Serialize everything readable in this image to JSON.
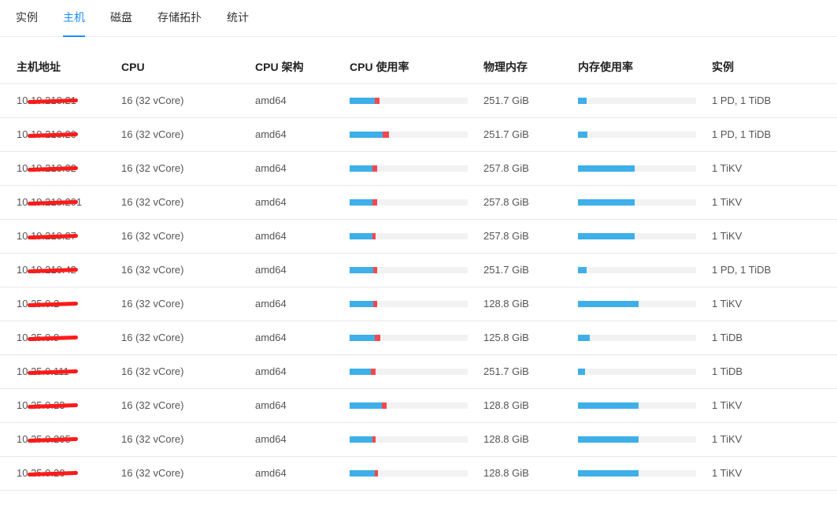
{
  "tabs": [
    {
      "label": "实例"
    },
    {
      "label": "主机",
      "active": true
    },
    {
      "label": "磁盘"
    },
    {
      "label": "存储拓扑"
    },
    {
      "label": "统计"
    }
  ],
  "columns": [
    "主机地址",
    "CPU",
    "CPU 架构",
    "CPU 使用率",
    "物理内存",
    "内存使用率",
    "实例"
  ],
  "colors": {
    "accent": "#1890ff",
    "cpu_user": "#3eafe9",
    "cpu_system": "#f5484e",
    "redaction": "#ff1a1a"
  },
  "rows": [
    {
      "address": "10.19.210.21",
      "cpu": "16 (32 vCore)",
      "arch": "amd64",
      "cpu_user": 0.21,
      "cpu_sys": 0.04,
      "memory": "251.7 GiB",
      "mem_usage": 0.07,
      "instances": "1 PD, 1 TiDB"
    },
    {
      "address": "10.19.210.20",
      "cpu": "16 (32 vCore)",
      "arch": "amd64",
      "cpu_user": 0.28,
      "cpu_sys": 0.05,
      "memory": "251.7 GiB",
      "mem_usage": 0.08,
      "instances": "1 PD, 1 TiDB"
    },
    {
      "address": "10.19.210.32",
      "cpu": "16 (32 vCore)",
      "arch": "amd64",
      "cpu_user": 0.19,
      "cpu_sys": 0.04,
      "memory": "257.8 GiB",
      "mem_usage": 0.48,
      "instances": "1 TiKV"
    },
    {
      "address": "10.19.210.201",
      "cpu": "16 (32 vCore)",
      "arch": "amd64",
      "cpu_user": 0.19,
      "cpu_sys": 0.04,
      "memory": "257.8 GiB",
      "mem_usage": 0.48,
      "instances": "1 TiKV"
    },
    {
      "address": "10.19.210.27",
      "cpu": "16 (32 vCore)",
      "arch": "amd64",
      "cpu_user": 0.19,
      "cpu_sys": 0.03,
      "memory": "257.8 GiB",
      "mem_usage": 0.48,
      "instances": "1 TiKV"
    },
    {
      "address": "10.19.210.42",
      "cpu": "16 (32 vCore)",
      "arch": "amd64",
      "cpu_user": 0.2,
      "cpu_sys": 0.03,
      "memory": "251.7 GiB",
      "mem_usage": 0.07,
      "instances": "1 PD, 1 TiDB"
    },
    {
      "address": "10.25.0.2",
      "cpu": "16 (32 vCore)",
      "arch": "amd64",
      "cpu_user": 0.2,
      "cpu_sys": 0.03,
      "memory": "128.8 GiB",
      "mem_usage": 0.51,
      "instances": "1 TiKV"
    },
    {
      "address": "10.25.0.9",
      "cpu": "16 (32 vCore)",
      "arch": "amd64",
      "cpu_user": 0.21,
      "cpu_sys": 0.05,
      "memory": "125.8 GiB",
      "mem_usage": 0.1,
      "instances": "1 TiDB"
    },
    {
      "address": "10.25.0.111",
      "cpu": "16 (32 vCore)",
      "arch": "amd64",
      "cpu_user": 0.18,
      "cpu_sys": 0.04,
      "memory": "251.7 GiB",
      "mem_usage": 0.06,
      "instances": "1 TiDB"
    },
    {
      "address": "10.25.0.23",
      "cpu": "16 (32 vCore)",
      "arch": "amd64",
      "cpu_user": 0.27,
      "cpu_sys": 0.04,
      "memory": "128.8 GiB",
      "mem_usage": 0.51,
      "instances": "1 TiKV"
    },
    {
      "address": "10.25.0.205",
      "cpu": "16 (32 vCore)",
      "arch": "amd64",
      "cpu_user": 0.19,
      "cpu_sys": 0.03,
      "memory": "128.8 GiB",
      "mem_usage": 0.51,
      "instances": "1 TiKV"
    },
    {
      "address": "10.25.0.20",
      "cpu": "16 (32 vCore)",
      "arch": "amd64",
      "cpu_user": 0.21,
      "cpu_sys": 0.03,
      "memory": "128.8 GiB",
      "mem_usage": 0.51,
      "instances": "1 TiKV"
    }
  ]
}
